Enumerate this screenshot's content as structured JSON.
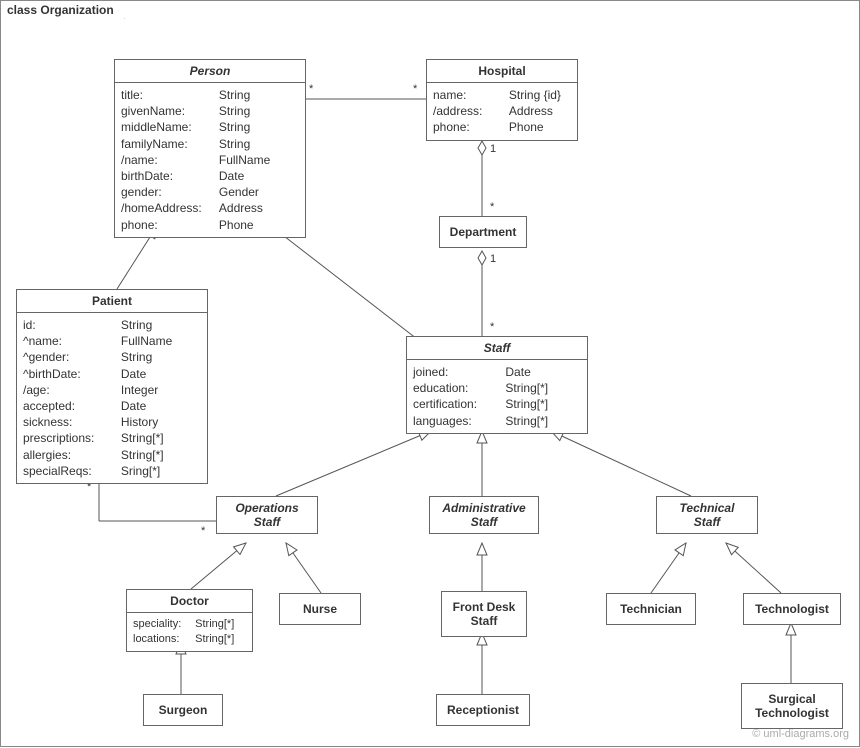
{
  "frame_title": "class Organization",
  "credit": "© uml-diagrams.org",
  "classes": {
    "person": {
      "name": "Person",
      "attrs": [
        {
          "k": "title:",
          "v": "String"
        },
        {
          "k": "givenName:",
          "v": "String"
        },
        {
          "k": "middleName:",
          "v": "String"
        },
        {
          "k": "familyName:",
          "v": "String"
        },
        {
          "k": "/name:",
          "v": "FullName"
        },
        {
          "k": "birthDate:",
          "v": "Date"
        },
        {
          "k": "gender:",
          "v": "Gender"
        },
        {
          "k": "/homeAddress:",
          "v": "Address"
        },
        {
          "k": "phone:",
          "v": "Phone"
        }
      ]
    },
    "hospital": {
      "name": "Hospital",
      "attrs": [
        {
          "k": "name:",
          "v": "String {id}"
        },
        {
          "k": "/address:",
          "v": "Address"
        },
        {
          "k": "phone:",
          "v": "Phone"
        }
      ]
    },
    "department": {
      "name": "Department"
    },
    "patient": {
      "name": "Patient",
      "attrs": [
        {
          "k": "id:",
          "v": "String"
        },
        {
          "k": "^name:",
          "v": "FullName"
        },
        {
          "k": "^gender:",
          "v": "String"
        },
        {
          "k": "^birthDate:",
          "v": "Date"
        },
        {
          "k": "/age:",
          "v": "Integer"
        },
        {
          "k": "accepted:",
          "v": "Date"
        },
        {
          "k": "sickness:",
          "v": "History"
        },
        {
          "k": "prescriptions:",
          "v": "String[*]"
        },
        {
          "k": "allergies:",
          "v": "String[*]"
        },
        {
          "k": "specialReqs:",
          "v": "Sring[*]"
        }
      ]
    },
    "staff": {
      "name": "Staff",
      "attrs": [
        {
          "k": "joined:",
          "v": "Date"
        },
        {
          "k": "education:",
          "v": "String[*]"
        },
        {
          "k": "certification:",
          "v": "String[*]"
        },
        {
          "k": "languages:",
          "v": "String[*]"
        }
      ]
    },
    "operations_staff": {
      "name": "Operations\nStaff"
    },
    "administrative_staff": {
      "name": "Administrative\nStaff"
    },
    "technical_staff": {
      "name": "Technical\nStaff"
    },
    "doctor": {
      "name": "Doctor",
      "attrs": [
        {
          "k": "speciality:",
          "v": "String[*]"
        },
        {
          "k": "locations:",
          "v": "String[*]"
        }
      ]
    },
    "nurse": {
      "name": "Nurse"
    },
    "front_desk_staff": {
      "name": "Front Desk\nStaff"
    },
    "technician": {
      "name": "Technician"
    },
    "technologist": {
      "name": "Technologist"
    },
    "surgeon": {
      "name": "Surgeon"
    },
    "receptionist": {
      "name": "Receptionist"
    },
    "surgical_tech": {
      "name": "Surgical\nTechnologist"
    }
  },
  "mult": {
    "person_hosp_left": "*",
    "person_hosp_right": "*",
    "hosp_dept": "1",
    "dept_top": "*",
    "dept_staff": "1",
    "staff_top": "*",
    "patient_ops_left": "*",
    "patient_ops_right": "*"
  }
}
